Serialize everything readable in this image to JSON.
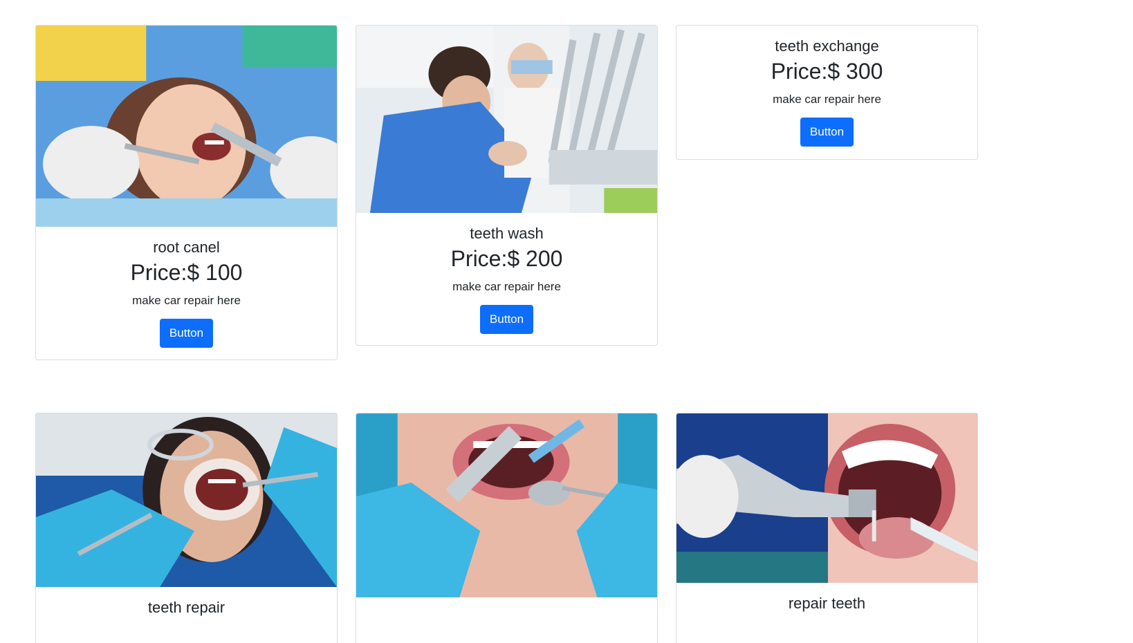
{
  "cards": [
    {
      "title": "root canel",
      "price": "Price:$ 100",
      "text": "make car repair here",
      "button_label": "Button",
      "image": "dentist-patient-photo",
      "colors": {
        "bg": "#4a90d9",
        "skin": "#f2c9b1",
        "accent": "#e8e8e8"
      }
    },
    {
      "title": "teeth wash",
      "price": "Price:$ 200",
      "text": "make car repair here",
      "button_label": "Button",
      "image": "dentist-clinic-photo",
      "colors": {
        "bg": "#dfe6ea",
        "skin": "#3a7bd5",
        "accent": "#c0c8cf"
      }
    },
    {
      "title": "teeth exchange",
      "price": "Price:$ 300",
      "text": "make car repair here",
      "button_label": "Button"
    },
    {
      "title": "teeth repair",
      "image": "dental-exam-photo",
      "colors": {
        "bg": "#1e5aa8",
        "skin": "#e0b49a",
        "accent": "#35b3e0"
      }
    },
    {
      "image": "dental-tools-mouth-photo",
      "colors": {
        "bg": "#2aa0c8",
        "skin": "#e9a7a3",
        "accent": "#bfc7cc"
      }
    },
    {
      "title": "repair teeth",
      "image": "dental-drill-photo",
      "colors": {
        "bg": "#1a3f8c",
        "skin": "#f0c4b8",
        "accent": "#d0d6dc"
      }
    }
  ],
  "brand_button_color": "#0d6efd"
}
